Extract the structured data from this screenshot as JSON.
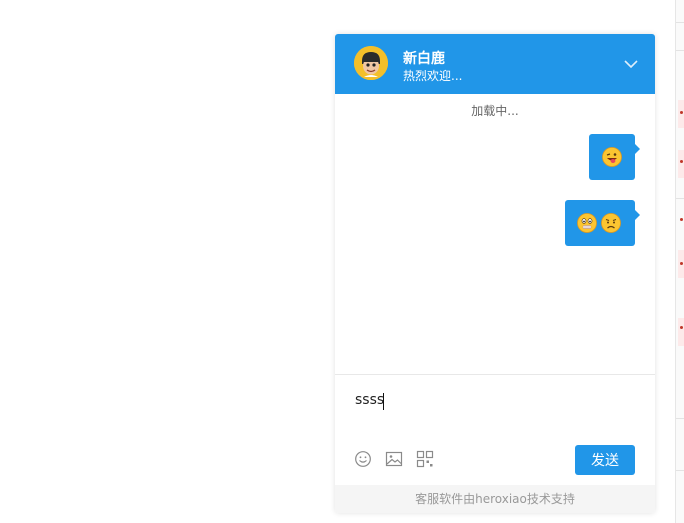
{
  "header": {
    "name": "新白鹿",
    "status": "热烈欢迎..."
  },
  "messages_area": {
    "loading": "加载中..."
  },
  "messages": [
    {
      "emoji": [
        "grinning-tongue-emoji"
      ]
    },
    {
      "emoji": [
        "hush-emoji",
        "frown-emoji"
      ]
    }
  ],
  "input": {
    "value": "ssss"
  },
  "toolbar": {
    "tools": [
      "smiley-icon",
      "image-icon",
      "qr-code-icon"
    ],
    "send_label": "发送"
  },
  "footer": {
    "text": "客服软件由heroxiao技术支持"
  },
  "colors": {
    "accent": "#2196e8",
    "footer_bg": "#f5f5f5"
  }
}
